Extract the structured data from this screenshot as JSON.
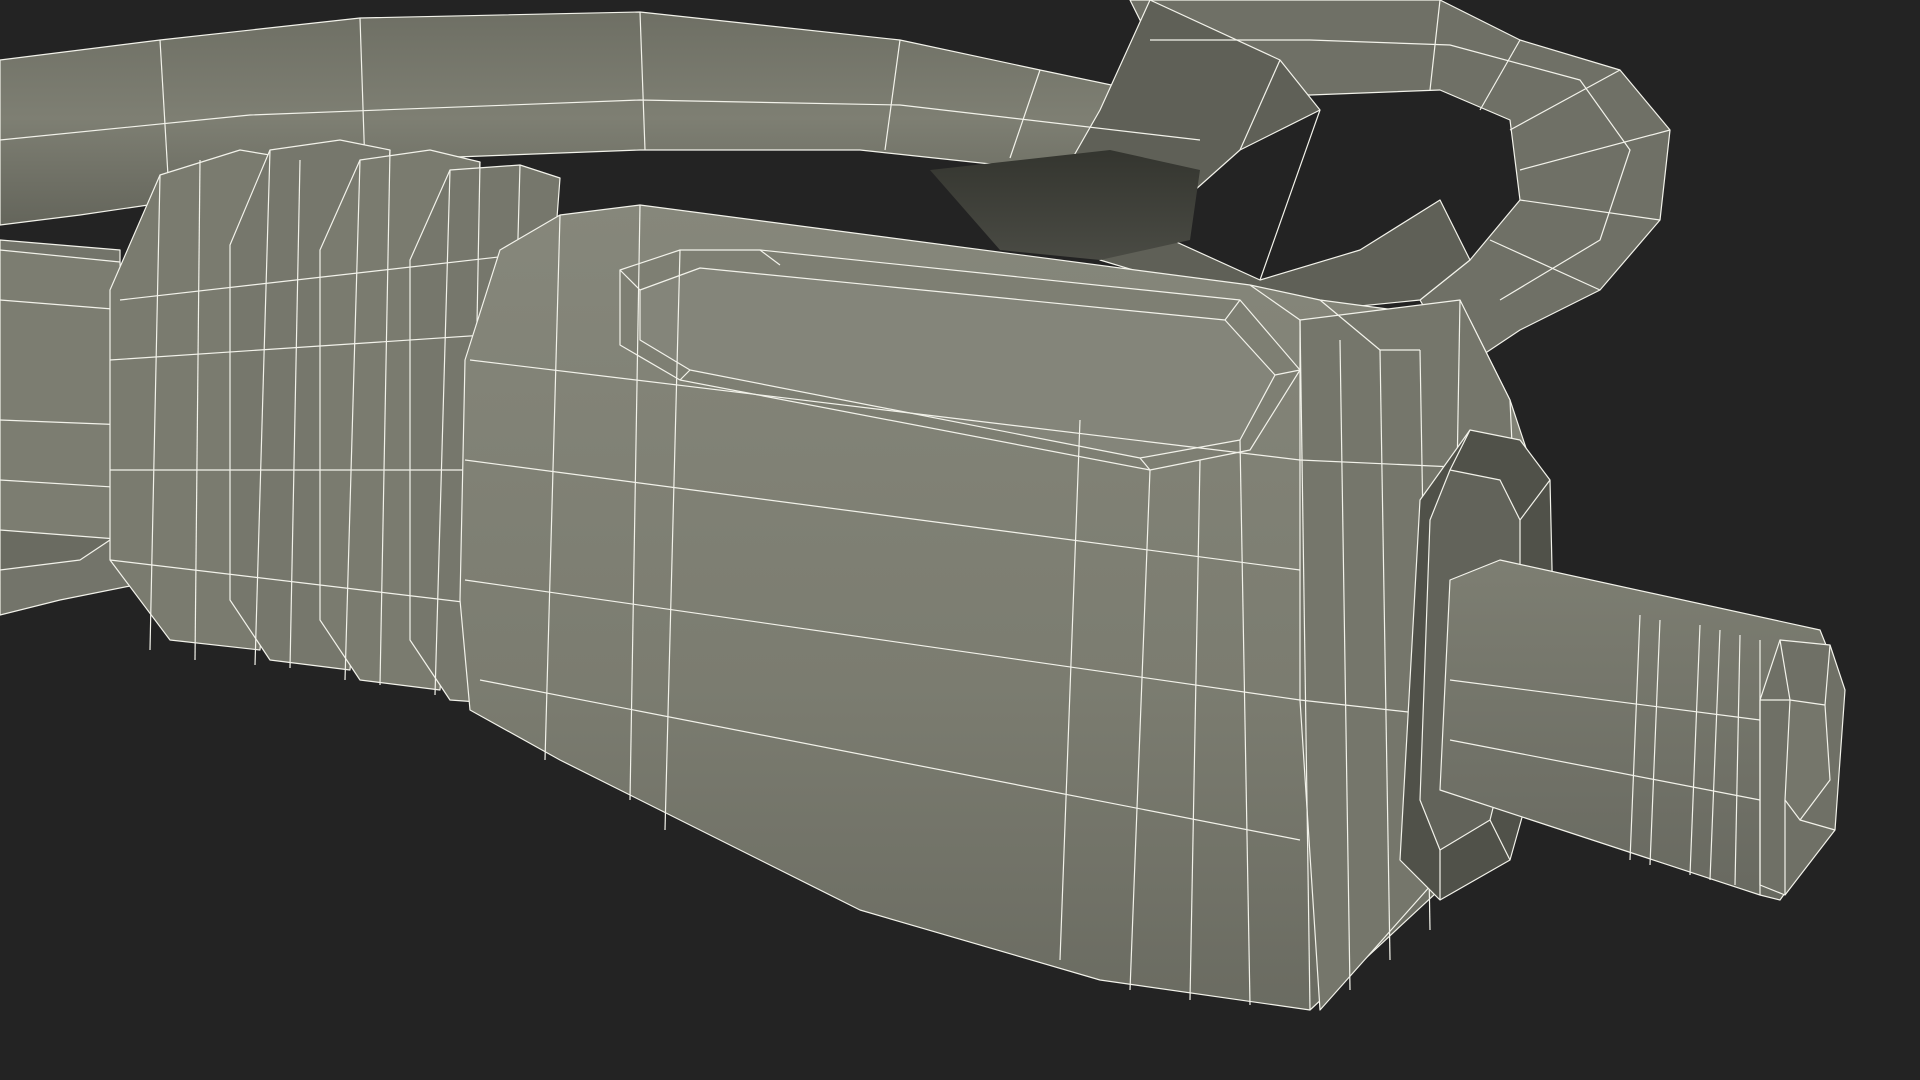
{
  "scene": {
    "subject": "cable-connector-wireframe",
    "colors": {
      "background": "#232323",
      "surface": "#7b7b6f",
      "surface_light": "#85857a",
      "surface_dark": "#5d5e55",
      "shadow": "#3d3e38",
      "wire": "#f2f2ea"
    }
  }
}
